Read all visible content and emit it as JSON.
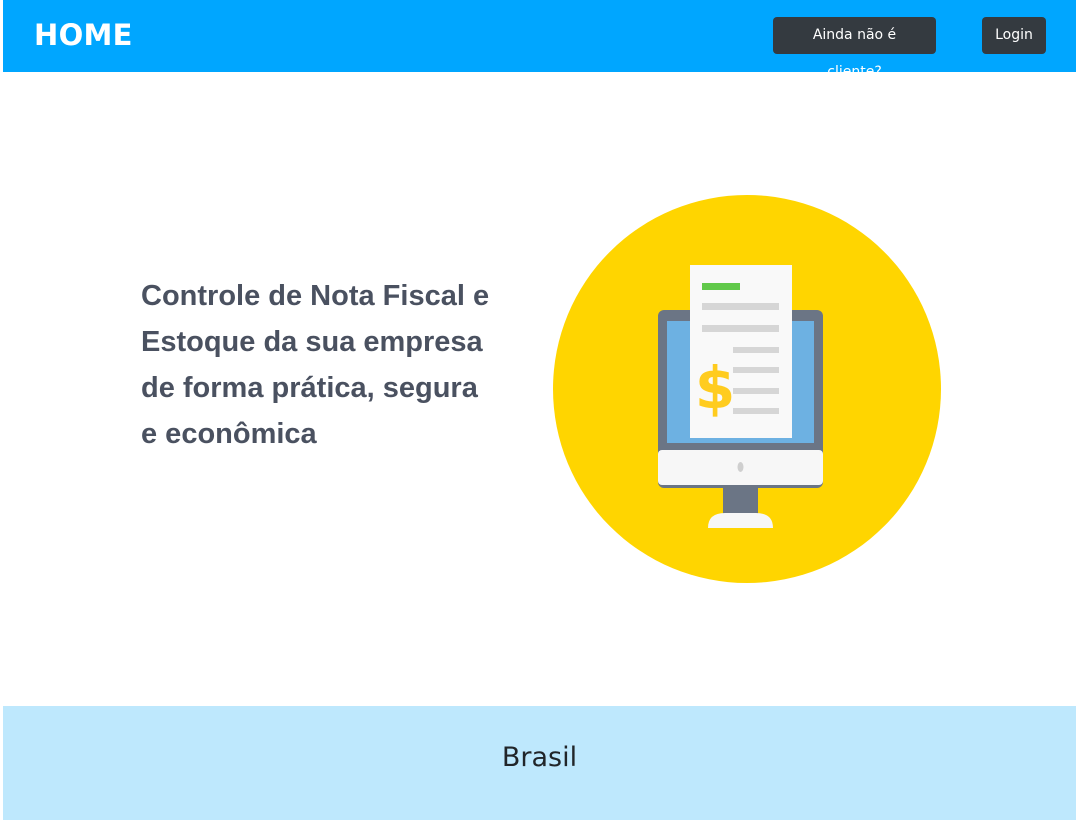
{
  "navbar": {
    "brand": "HOME",
    "signup_label": "Ainda não é cliente?",
    "login_label": "Login",
    "background_color": "#00a6ff",
    "button_color": "#343a40"
  },
  "hero": {
    "lines": [
      "Controle de Nota Fiscal e",
      "Estoque da sua empresa",
      "de forma prática, segura",
      "e econômica"
    ],
    "illustration_icon": "invoice-monitor-icon",
    "illustration_bg": "#ffd500"
  },
  "footer": {
    "text": "Brasil",
    "background_color": "#bee8fd"
  }
}
